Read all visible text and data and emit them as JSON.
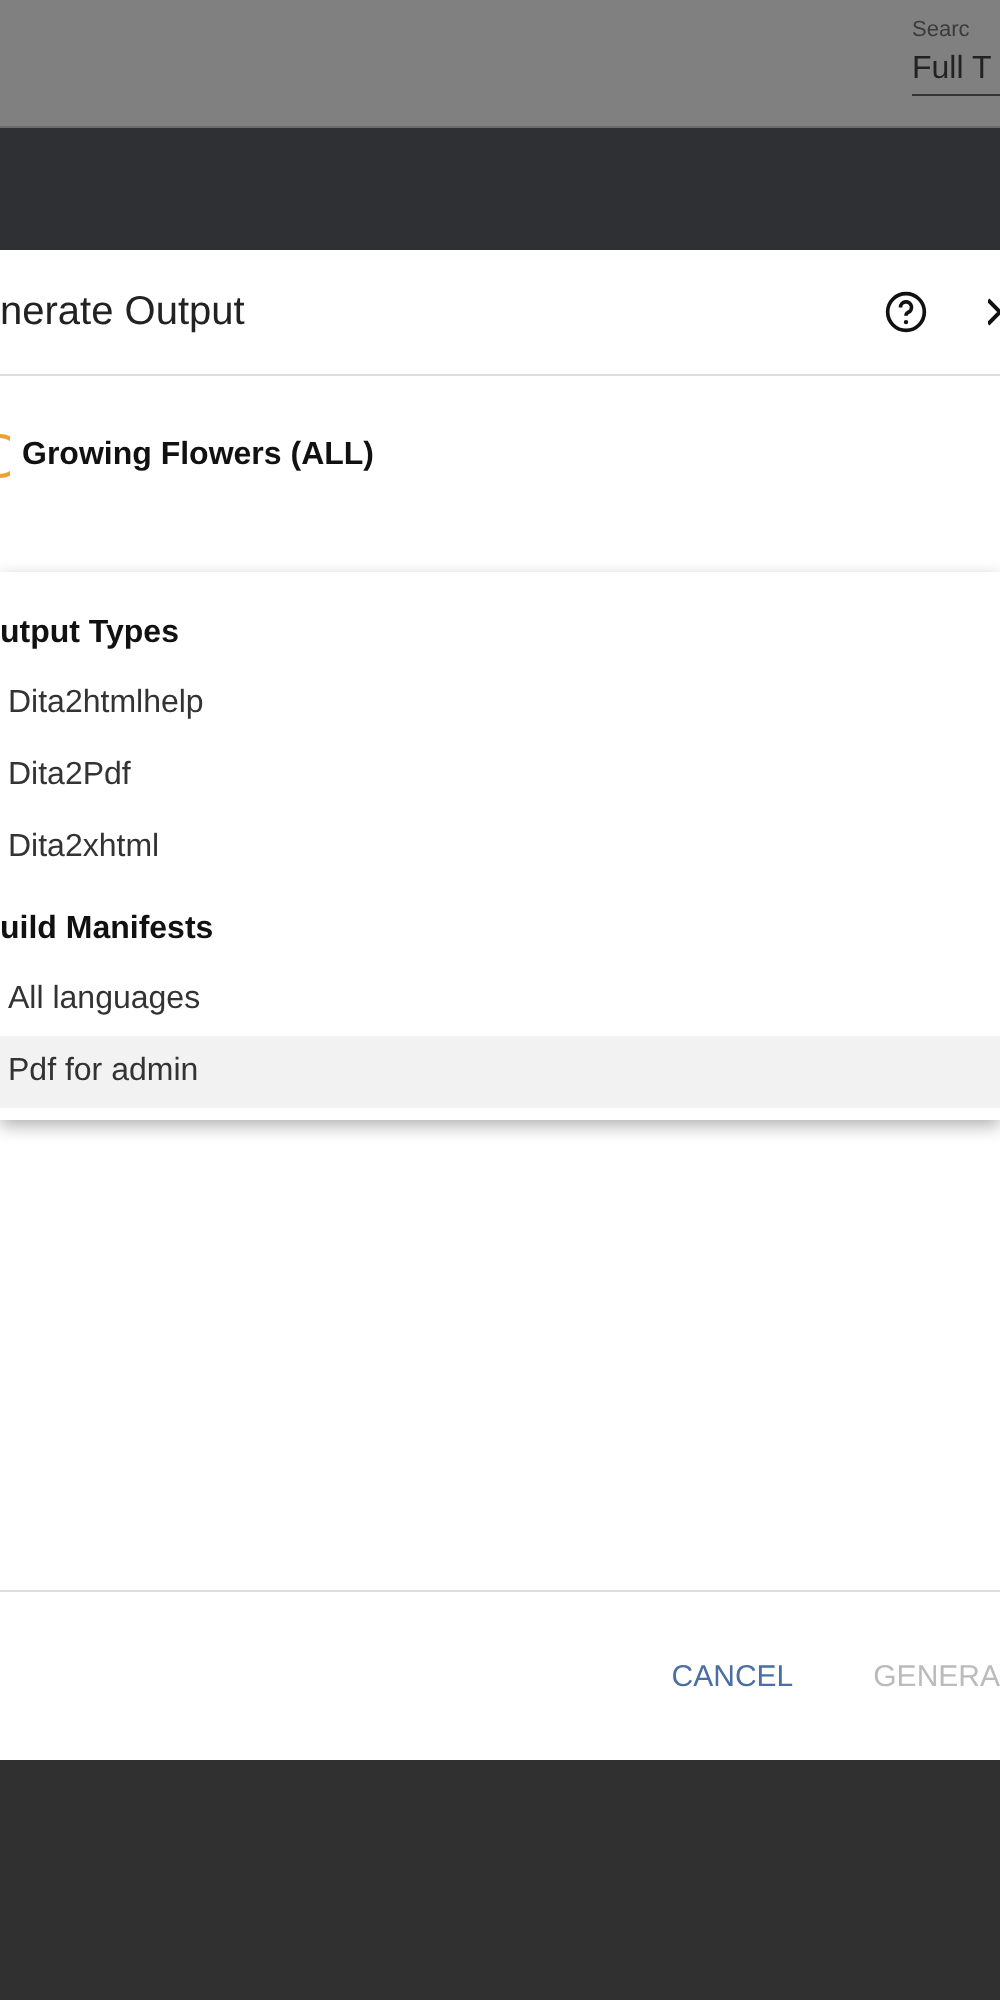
{
  "top_bar": {
    "search_label": "Searc",
    "search_value": "Full T"
  },
  "dialog": {
    "title": "nerate Output",
    "publication": "Growing Flowers (ALL)",
    "menu": {
      "groups": [
        {
          "heading": "utput Types",
          "items": [
            {
              "label": "Dita2htmlhelp",
              "selected": false
            },
            {
              "label": "Dita2Pdf",
              "selected": false
            },
            {
              "label": "Dita2xhtml",
              "selected": false
            }
          ]
        },
        {
          "heading": "uild Manifests",
          "items": [
            {
              "label": "All languages",
              "selected": false
            },
            {
              "label": "Pdf for admin",
              "selected": true
            }
          ]
        }
      ]
    },
    "buttons": [
      {
        "label": "CANCEL",
        "disabled": false
      },
      {
        "label": "GENERA",
        "disabled": true
      }
    ]
  }
}
